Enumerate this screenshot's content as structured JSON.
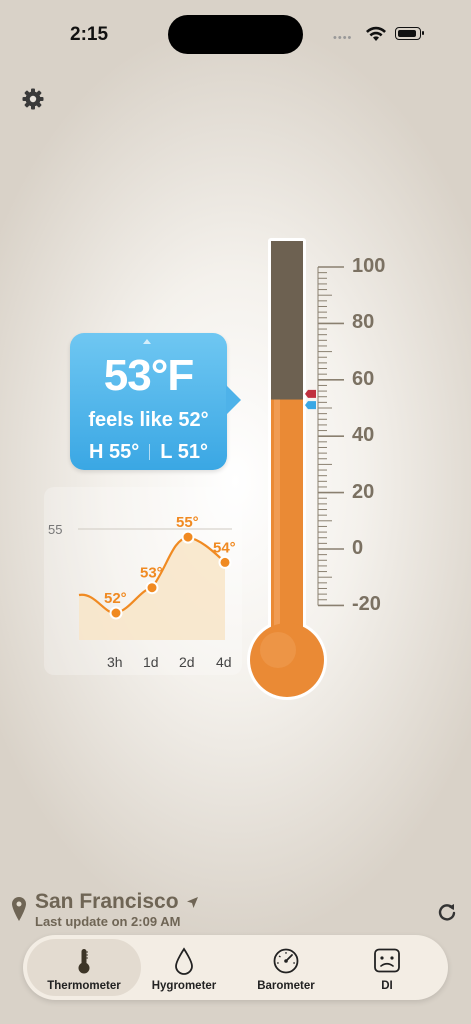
{
  "status": {
    "time": "2:15",
    "dots": "••••"
  },
  "bubble": {
    "temperature": "53°F",
    "feels_like": "feels like 52°",
    "high": "H 55°",
    "low": "L 51°"
  },
  "graph": {
    "y_reference": "55",
    "points": [
      {
        "x": "3h",
        "label": "52°",
        "value": 52
      },
      {
        "x": "1d",
        "label": "53°",
        "value": 53
      },
      {
        "x": "2d",
        "label": "55°",
        "value": 55
      },
      {
        "x": "4d",
        "label": "54°",
        "value": 54
      }
    ]
  },
  "thermometer": {
    "scale_labels": [
      "100",
      "80",
      "60",
      "40",
      "20",
      "0",
      "-20"
    ],
    "current": 53,
    "scale_min": -20,
    "scale_max": 100,
    "fill_color": "#ea8a35",
    "empty_color": "#6d6151"
  },
  "location": {
    "city": "San Francisco",
    "last_update": "Last update on 2:09 AM"
  },
  "tabs": [
    {
      "label": "Thermometer",
      "icon": "thermometer-icon",
      "active": true
    },
    {
      "label": "Hygrometer",
      "icon": "droplet-icon",
      "active": false
    },
    {
      "label": "Barometer",
      "icon": "gauge-icon",
      "active": false
    },
    {
      "label": "DI",
      "icon": "sad-face-icon",
      "active": false
    }
  ]
}
